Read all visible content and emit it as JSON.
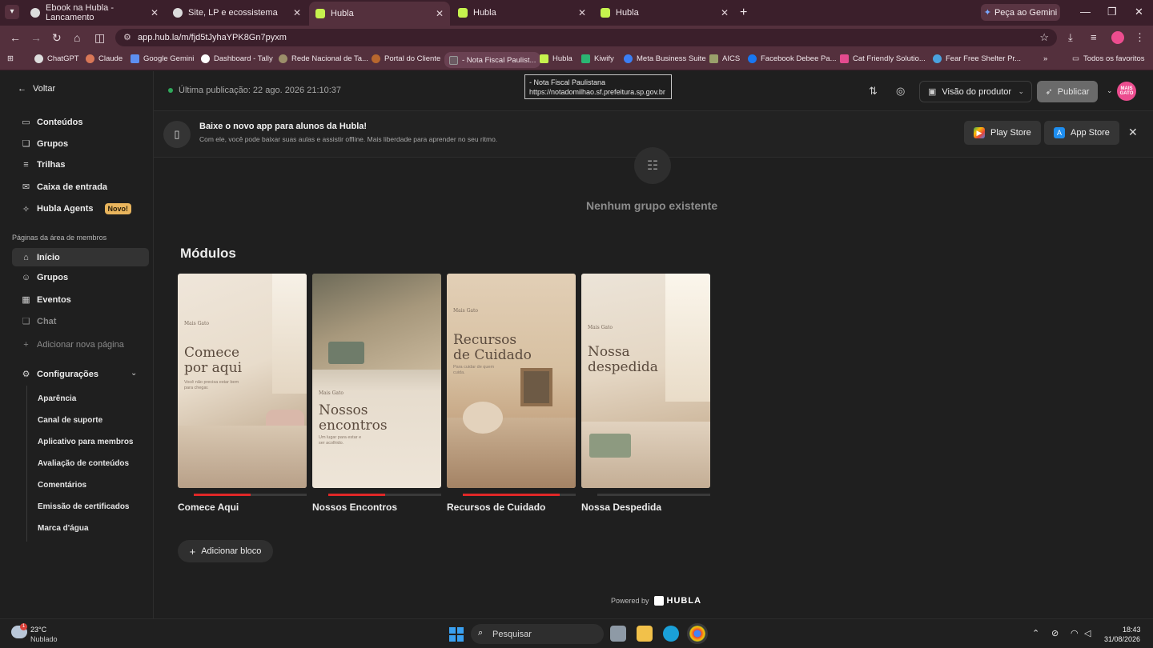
{
  "browser": {
    "tabs": [
      {
        "title": "Ebook na Hubla - Lancamento"
      },
      {
        "title": "Site, LP e ecossistema"
      },
      {
        "title": "Hubla"
      },
      {
        "title": "Hubla"
      },
      {
        "title": "Hubla"
      }
    ],
    "gemini_label": "Peça ao Gemini",
    "url": "app.hub.la/m/fjd5tJyhaYPK8Gn7pyxm",
    "bookmarks": [
      "ChatGPT",
      "Claude",
      "Google Gemini",
      "Dashboard - Tally",
      "Rede Nacional de Ta...",
      "Portal do Cliente",
      "- Nota Fiscal Paulist...",
      "Hubla",
      "Kiwify",
      "Meta Business Suite",
      "AICS",
      "Facebook Debee Pa...",
      "Cat Friendly Solutio...",
      "Fear Free Shelter Pr..."
    ],
    "all_favorites": "Todos os favoritos",
    "tooltip": {
      "line1": "- Nota Fiscal Paulistana",
      "line2": "https://notadomilhao.sf.prefeitura.sp.gov.br"
    }
  },
  "sidebar": {
    "back": "Voltar",
    "main_items": [
      "Conteúdos",
      "Grupos",
      "Trilhas",
      "Caixa de entrada",
      "Hubla Agents"
    ],
    "badge_new": "Novo!",
    "section_title": "Páginas da área de membros",
    "page_items": [
      "Início",
      "Grupos",
      "Eventos",
      "Chat"
    ],
    "add_page": "Adicionar nova página",
    "settings": "Configurações",
    "settings_items": [
      "Aparência",
      "Canal de suporte",
      "Aplicativo para membros",
      "Avaliação de conteúdos",
      "Comentários",
      "Emissão de certificados",
      "Marca d'água"
    ]
  },
  "topbar": {
    "status": "Última publicação: 22 ago. 2026 21:10:37",
    "view_label": "Visão do produtor",
    "publish": "Publicar",
    "avatar_text": "MAIS GATO"
  },
  "banner": {
    "title": "Baixe o novo app para alunos da Hubla!",
    "subtitle": "Com ele, você pode baixar suas aulas e assistir offline. Mais liberdade para aprender no seu ritmo.",
    "play_store": "Play Store",
    "app_store": "App Store"
  },
  "groups_empty": "Nenhum grupo existente",
  "modules": {
    "title": "Módulos",
    "items": [
      {
        "label": "Comece Aqui",
        "cover_line1": "Comece",
        "cover_line2": "por aqui",
        "cover_tag": "Você não precisa estar bem para chegar.",
        "progress": 0.5
      },
      {
        "label": "Nossos Encontros",
        "cover_line1": "Nossos",
        "cover_line2": "encontros",
        "cover_tag": "Um lugar para estar e ser acolhido.",
        "progress": 0.5
      },
      {
        "label": "Recursos de Cuidado",
        "cover_line1": "Recursos",
        "cover_line2": "de Cuidado",
        "cover_tag": "Para cuidar de quem cuida.",
        "progress": 0.86
      },
      {
        "label": "Nossa Despedida",
        "cover_line1": "Nossa",
        "cover_line2": "despedida",
        "cover_tag": "",
        "progress": 0
      }
    ],
    "cover_brand": "Mais Gato"
  },
  "add_block": "Adicionar bloco",
  "powered_by": "Powered by",
  "powered_brand": "HUBLA",
  "taskbar": {
    "temp": "23°C",
    "weather": "Nublado",
    "search": "Pesquisar",
    "time": "18:43",
    "date": "31/08/2026"
  }
}
